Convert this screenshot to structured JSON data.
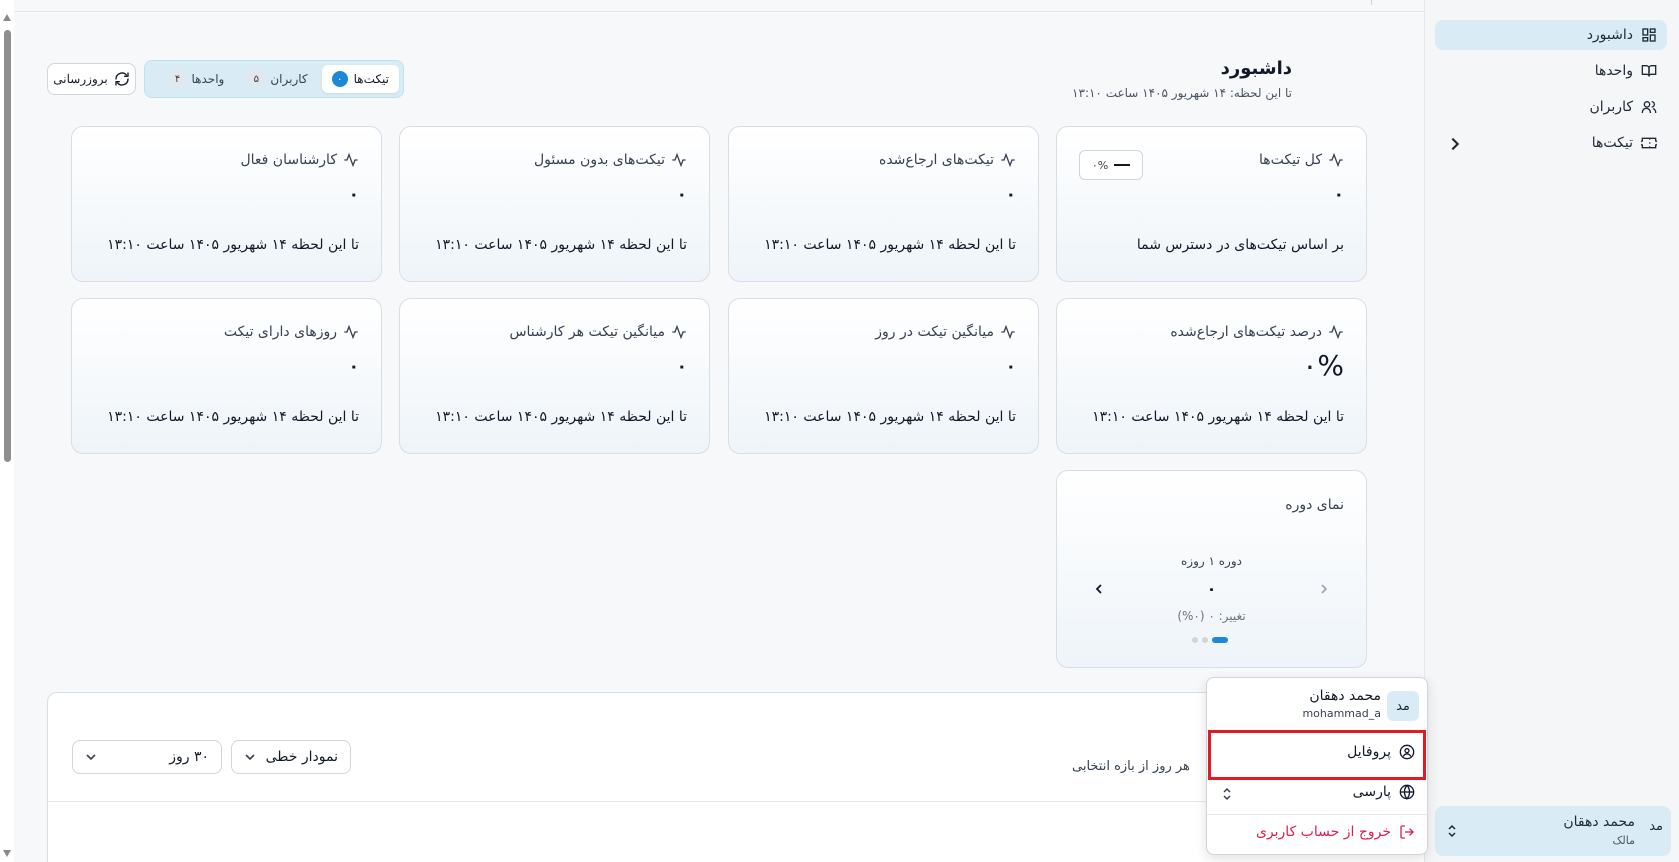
{
  "sidebar": {
    "items": [
      {
        "label": "داشبورد",
        "icon": "dashboard-icon",
        "active": true
      },
      {
        "label": "واحدها",
        "icon": "book-icon"
      },
      {
        "label": "کاربران",
        "icon": "users-icon"
      },
      {
        "label": "تیکت‌ها",
        "icon": "ticket-icon"
      }
    ],
    "user": {
      "avatar": "مد",
      "name": "محمد دهقان",
      "role": "مالک"
    }
  },
  "header": {
    "title": "داشبورد",
    "subtitle": "تا این لحظه: ۱۴ شهریور ۱۴۰۵ ساعت ۱۳:۱۰",
    "refresh_label": "بروزرسانی",
    "tabs": [
      {
        "label": "تیکت‌ها",
        "count": "۰",
        "active": true
      },
      {
        "label": "کاربران",
        "count": "۵"
      },
      {
        "label": "واحدها",
        "count": "۴"
      }
    ]
  },
  "cards": [
    {
      "title": "کل تیکت‌ها",
      "value": "۰",
      "footer": "بر اساس تیکت‌های در دسترس شما",
      "chip": "۰%"
    },
    {
      "title": "تیکت‌های ارجاع‌شده",
      "value": "۰",
      "footer": "تا این لحظه ۱۴ شهریور ۱۴۰۵ ساعت ۱۳:۱۰"
    },
    {
      "title": "تیکت‌های بدون مسئول",
      "value": "۰",
      "footer": "تا این لحظه ۱۴ شهریور ۱۴۰۵ ساعت ۱۳:۱۰"
    },
    {
      "title": "کارشناسان فعال",
      "value": "۰",
      "footer": "تا این لحظه ۱۴ شهریور ۱۴۰۵ ساعت ۱۳:۱۰"
    },
    {
      "title": "درصد تیکت‌های ارجاع‌شده",
      "value": "۰%",
      "footer": "تا این لحظه ۱۴ شهریور ۱۴۰۵ ساعت ۱۳:۱۰"
    },
    {
      "title": "میانگین تیکت در روز",
      "value": "۰",
      "footer": "تا این لحظه ۱۴ شهریور ۱۴۰۵ ساعت ۱۳:۱۰"
    },
    {
      "title": "میانگین تیکت هر کارشناس",
      "value": "۰",
      "footer": "تا این لحظه ۱۴ شهریور ۱۴۰۵ ساعت ۱۳:۱۰"
    },
    {
      "title": "روزهای دارای تیکت",
      "value": "۰",
      "footer": "تا این لحظه ۱۴ شهریور ۱۴۰۵ ساعت ۱۳:۱۰"
    }
  ],
  "period": {
    "title": "نمای دوره",
    "label": "دوره ۱ روزه",
    "value": "۰",
    "change": "تغییر: ۰ (۰%)",
    "dots": 3,
    "active_dot": 0
  },
  "chart_panel": {
    "description": "هر روز از بازه انتخابی",
    "chart_type": "نمودار خطی",
    "range": "۳۰ روز"
  },
  "user_menu": {
    "avatar": "مد",
    "name": "محمد دهقان",
    "username": "mohammad_a",
    "profile": "پروفایل",
    "language": "پارسی",
    "logout": "خروج از حساب کاربری"
  },
  "colors": {
    "accent": "#1e88d8",
    "active_bg": "#d9ecf6",
    "highlight": "#e01b24",
    "danger": "#e11d48"
  }
}
